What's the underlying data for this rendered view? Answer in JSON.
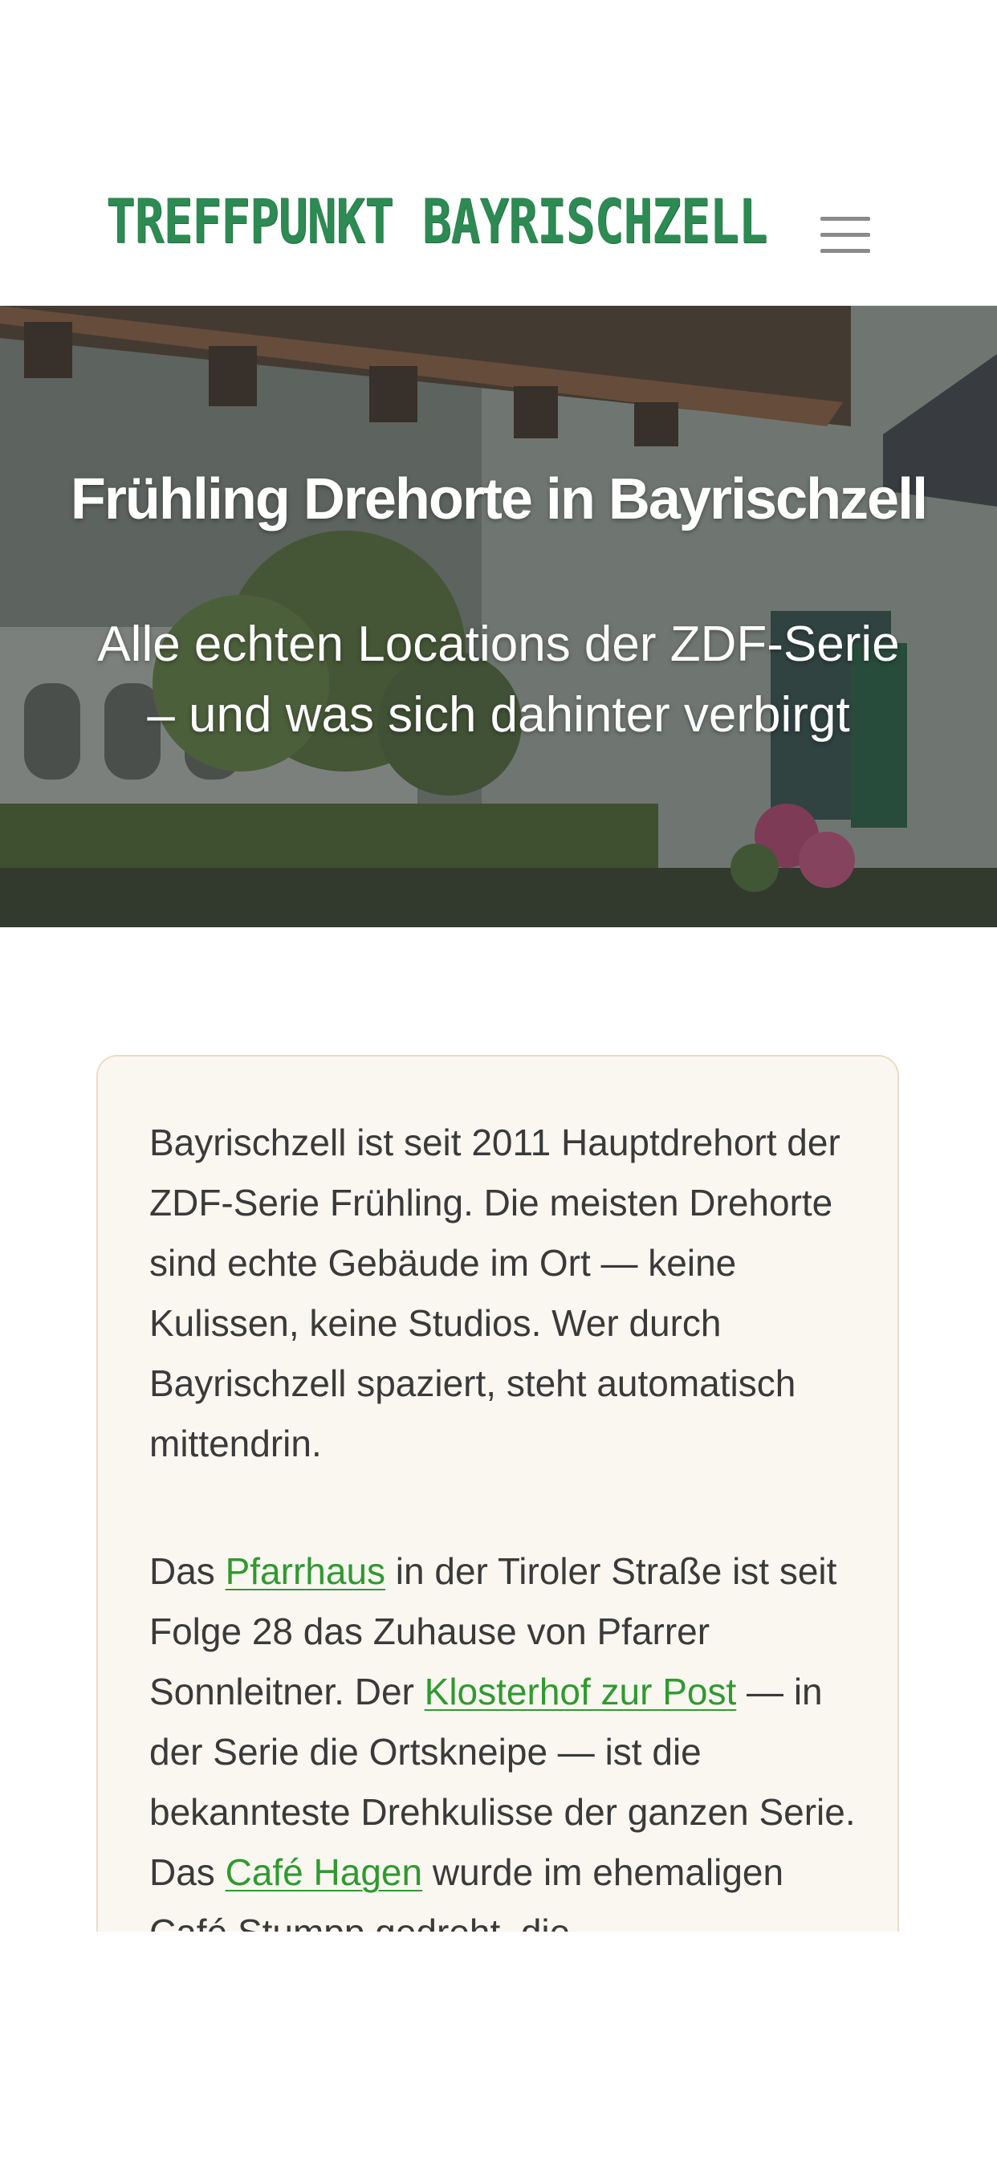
{
  "header": {
    "logo_text": "TREFFPUNKT BAYRISCHZELL",
    "menu_icon": "hamburger-menu-icon"
  },
  "hero": {
    "title": "Frühling Drehorte in Bayrischzell",
    "subtitle": "Alle echten Locations der ZDF-Serie – und was sich dahinter verbirgt"
  },
  "intro": {
    "paragraph1": "Bayrischzell ist seit 2011 Hauptdrehort der ZDF-Serie Frühling. Die meisten Drehorte sind echte Gebäude im Ort — keine Kulissen, keine Studios. Wer durch Bayrischzell spaziert, steht automatisch mittendrin.",
    "p2_a": "Das ",
    "link_pfarrhaus": "Pfarrhaus",
    "p2_b": " in der Tiroler Straße ist seit Folge 28 das Zuhause von Pfarrer Sonnleitner. Der ",
    "link_klosterhof": "Klosterhof zur Post",
    "p2_c": " — in der Serie die Ortskneipe — ist die bekannteste Drehkulisse der ganzen Serie. Das ",
    "link_cafe": "Café Hagen",
    "p2_d": " wurde im ehemaligen Café Stumpp gedreht, die"
  },
  "colors": {
    "brand_green": "#2c8a52",
    "link_green": "#2f9a2f",
    "card_bg": "#faf7f1",
    "card_border": "#ecdcc4"
  }
}
